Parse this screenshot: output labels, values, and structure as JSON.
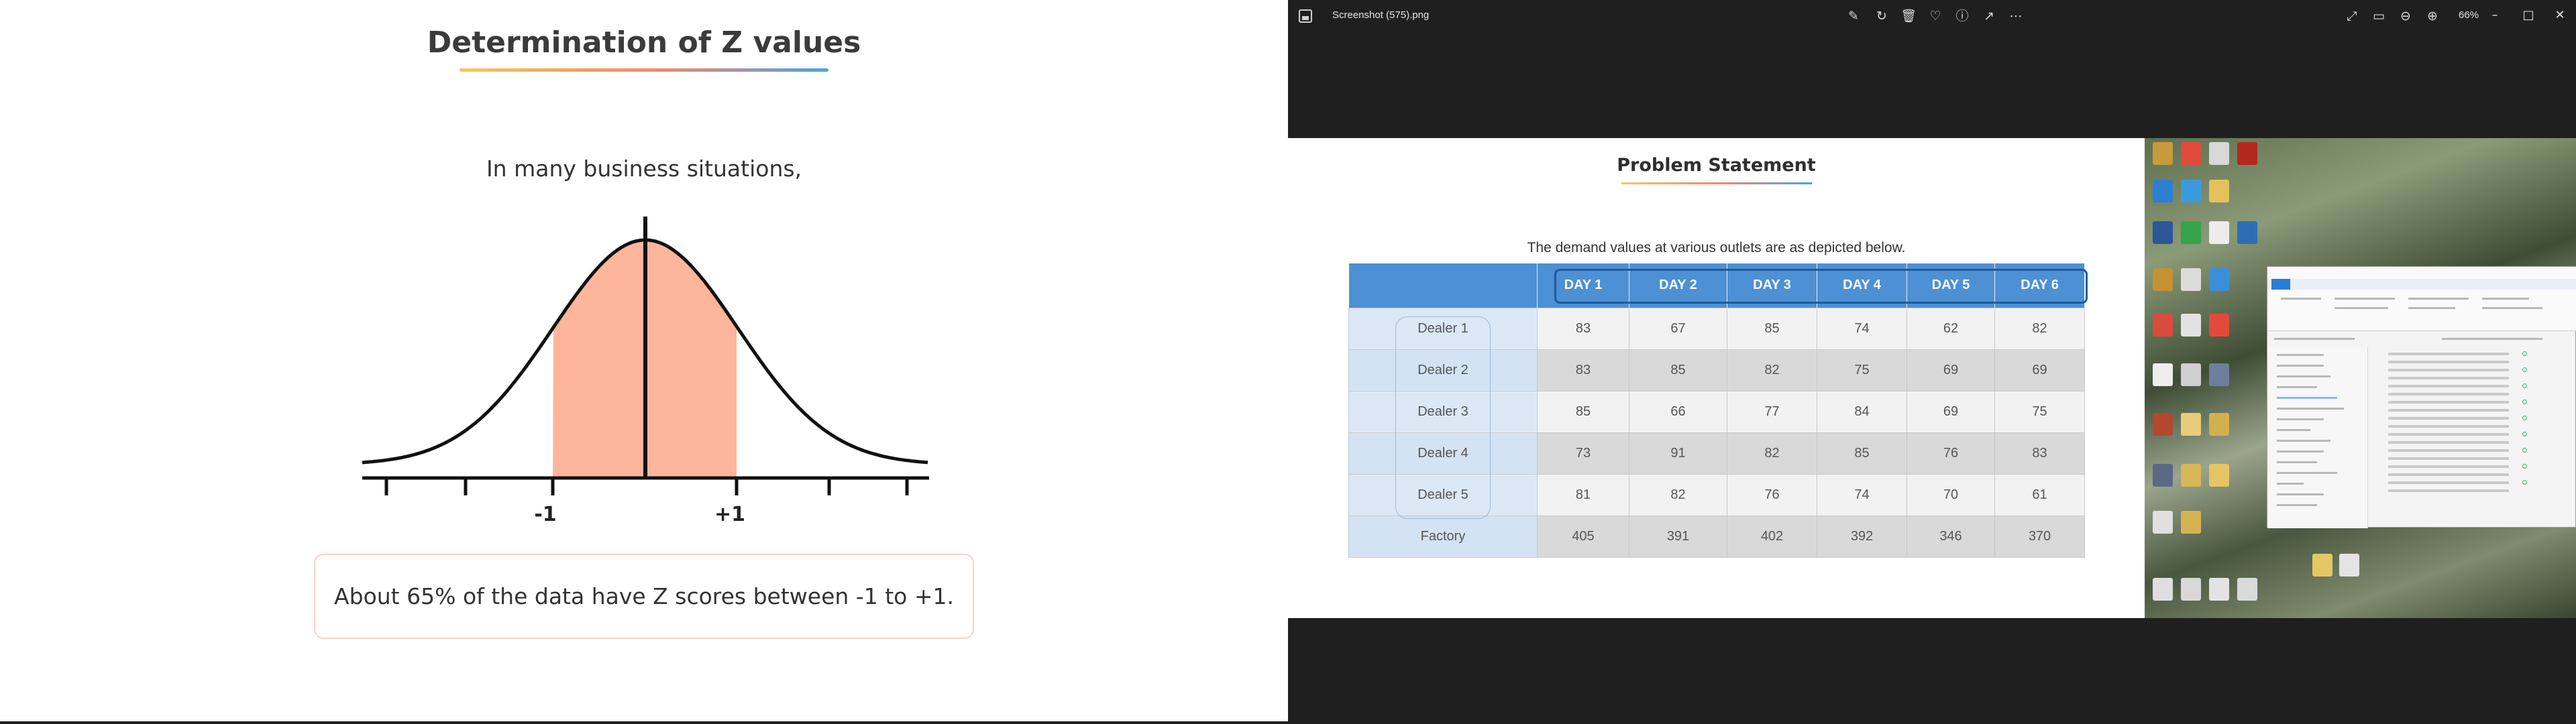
{
  "slide": {
    "title": "Determination of Z values",
    "subtitle": "In many business situations,",
    "curve": {
      "label_minus": "-1",
      "label_plus": "+1",
      "fill_color": "#fdb59b"
    },
    "callout": "About 65% of the data have Z scores between -1 to +1."
  },
  "viewer": {
    "filename": "Screenshot (575).png",
    "zoom": "66%",
    "toolbar_icons": [
      "edit-icon",
      "rotate-icon",
      "delete-icon",
      "favorite-icon",
      "info-icon",
      "share-icon",
      "more-icon"
    ],
    "window_controls": {
      "minimize": "–",
      "maximize": "□",
      "close": "✕"
    },
    "view_icons": [
      "expand-icon",
      "fit-icon",
      "zoom-out-icon",
      "zoom-in-icon"
    ]
  },
  "inner_slide": {
    "title": "Problem Statement",
    "subtitle": "The demand values at various outlets are as depicted below.",
    "table": {
      "headers": [
        "DAY 1",
        "DAY 2",
        "DAY 3",
        "DAY 4",
        "DAY 5",
        "DAY 6"
      ],
      "rows": [
        {
          "label": "Dealer 1",
          "values": [
            "83",
            "67",
            "85",
            "74",
            "62",
            "82"
          ]
        },
        {
          "label": "Dealer 2",
          "values": [
            "83",
            "85",
            "82",
            "75",
            "69",
            "69"
          ]
        },
        {
          "label": "Dealer 3",
          "values": [
            "85",
            "66",
            "77",
            "84",
            "69",
            "75"
          ]
        },
        {
          "label": "Dealer 4",
          "values": [
            "73",
            "91",
            "82",
            "85",
            "76",
            "83"
          ]
        },
        {
          "label": "Dealer 5",
          "values": [
            "81",
            "82",
            "76",
            "74",
            "70",
            "61"
          ]
        },
        {
          "label": "Factory",
          "values": [
            "405",
            "391",
            "402",
            "392",
            "346",
            "370"
          ]
        }
      ]
    }
  },
  "colors": {
    "viewer_bg": "#1f1f1f",
    "table_header": "#4d90d4",
    "accent_blue": "#1d5b9a"
  }
}
